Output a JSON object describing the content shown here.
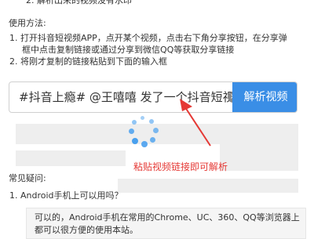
{
  "intro": {
    "item2": "2. 解析出来的视频没有水印"
  },
  "usage": {
    "title": "使用方法:",
    "step1_line1": "1. 打开抖音短视频APP，点开某个视频，点击右下角分享按钮，在分享弹",
    "step1_line2": "框中点击复制链接或通过分享到微信QQ等获取分享链接",
    "step2": "2. 将刚才复制的链接粘贴到下面的输入框"
  },
  "search": {
    "value": "#抖音上瘾# @王嘻嘻 发了一个抖音短视频",
    "clear_icon": "×",
    "button_label": "解析视频"
  },
  "annotation": {
    "text": "粘贴视频链接即可解析",
    "color": "#e53935"
  },
  "faq": {
    "title": "常见疑问:",
    "q1": "1. Android手机上可以用吗？",
    "a1_line1": "可以的，Android手机在常用的Chrome、UC、360、QQ等浏览器上",
    "a1_line2": "都可以很方便的使用本站。"
  },
  "colors": {
    "accent": "#3a8ee6",
    "spinner": "#49a0ee"
  }
}
